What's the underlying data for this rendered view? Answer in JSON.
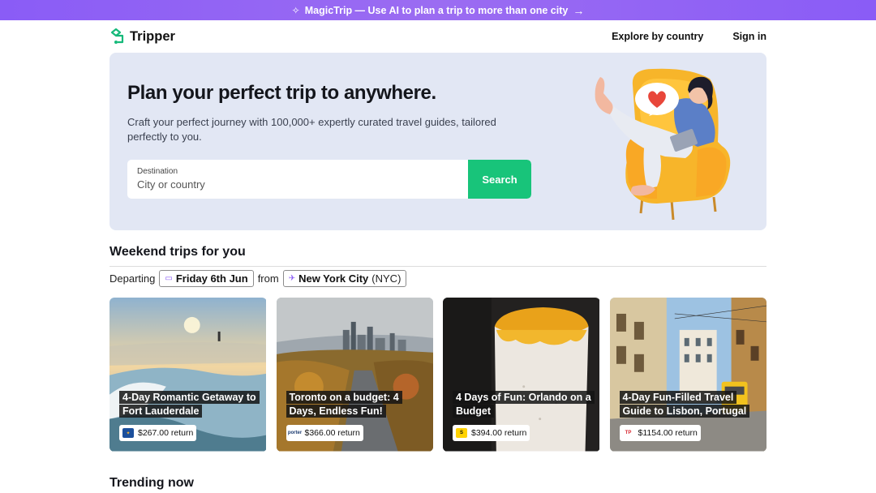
{
  "promo": {
    "label": "MagicTrip — Use AI to plan a trip to more than one city",
    "sparkle_icon": "sparkle-icon",
    "arrow_icon": "arrow-right-icon"
  },
  "nav": {
    "brand": "Tripper",
    "links": [
      "Explore by country",
      "Sign in"
    ]
  },
  "hero": {
    "title": "Plan your perfect trip to anywhere.",
    "subtitle": "Craft your perfect journey with 100,000+ expertly curated travel guides, tailored perfectly to you.",
    "search": {
      "label": "Destination",
      "placeholder": "City or country",
      "button": "Search"
    }
  },
  "weekend": {
    "title": "Weekend trips for you",
    "departing_label": "Departing",
    "date": "Friday 6th Jun",
    "from_label": "from",
    "city": "New York City",
    "city_code": "(NYC)"
  },
  "trips": [
    {
      "title": "4-Day Romantic Getaway to Fort Lauderdale",
      "price": "$267.00 return",
      "airline_icon": "airline-jetblue-icon"
    },
    {
      "title": "Toronto on a budget: 4 Days, Endless Fun!",
      "price": "$366.00 return",
      "airline_icon": "airline-porter-icon"
    },
    {
      "title": "4 Days of Fun: Orlando on a Budget",
      "price": "$394.00 return",
      "airline_icon": "airline-spirit-icon"
    },
    {
      "title": "4-Day Fun-Filled Travel Guide to Lisbon, Portugal",
      "price": "$1154.00 return",
      "airline_icon": "airline-tap-icon"
    }
  ],
  "trending": {
    "title": "Trending now"
  },
  "colors": {
    "accent": "#8a5cf6",
    "search_button": "#18c47a",
    "hero_bg": "#e2e7f4"
  }
}
